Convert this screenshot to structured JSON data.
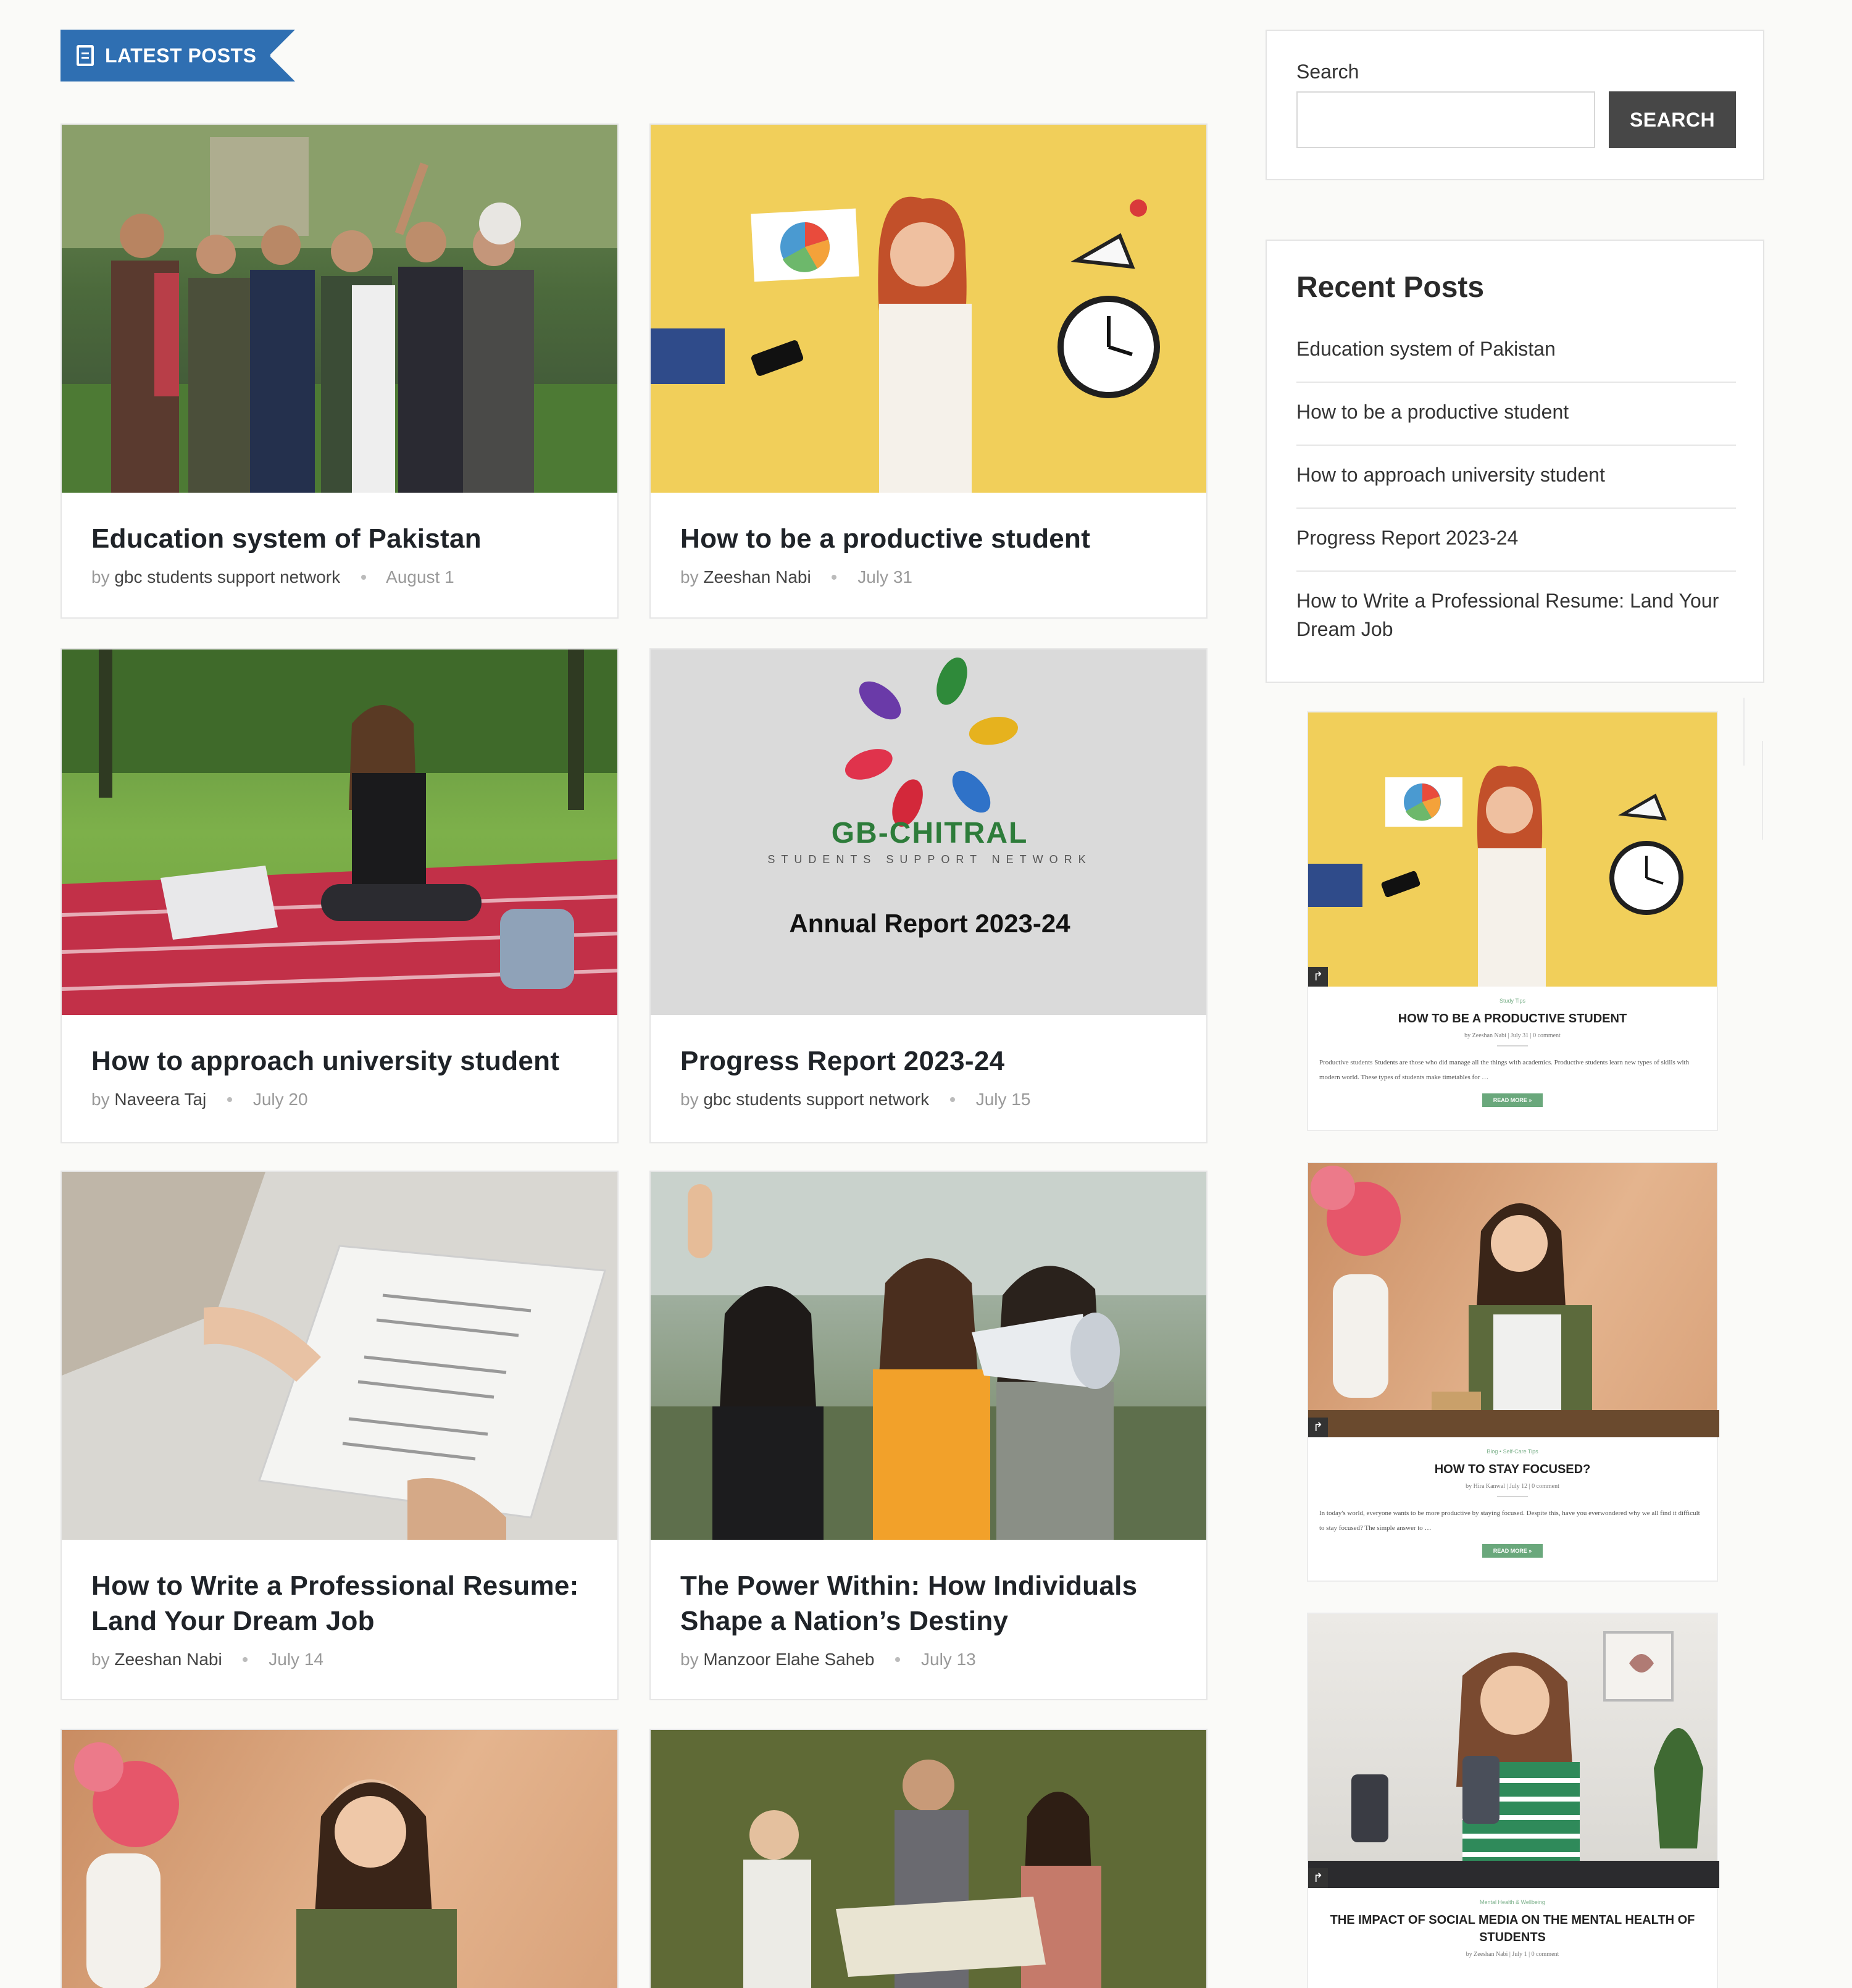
{
  "section_badge": {
    "label": "LATEST POSTS",
    "icon": "document-icon"
  },
  "posts": [
    {
      "title": "Education system of Pakistan",
      "by": "by",
      "author": "gbc students support network",
      "date": "August 1"
    },
    {
      "title": "How to be a productive student",
      "by": "by",
      "author": "Zeeshan Nabi",
      "date": "July 31"
    },
    {
      "title": "How to approach university student",
      "by": "by",
      "author": "Naveera Taj",
      "date": "July 20"
    },
    {
      "title": "Progress Report 2023-24",
      "by": "by",
      "author": "gbc students support network",
      "date": "July 15"
    },
    {
      "title": "How to Write a Professional Resume: Land Your Dream Job",
      "by": "by",
      "author": "Zeeshan Nabi",
      "date": "July 14"
    },
    {
      "title": "The Power Within: How Individuals Shape a Nation’s Destiny",
      "by": "by",
      "author": "Manzoor Elahe Saheb",
      "date": "July 13"
    }
  ],
  "report_image": {
    "brand": "GB-CHITRAL",
    "tagline": "STUDENTS SUPPORT NETWORK",
    "caption": "Annual Report 2023-24"
  },
  "search": {
    "label": "Search",
    "placeholder": "",
    "button": "SEARCH"
  },
  "recent_posts": {
    "title": "Recent Posts",
    "items": [
      "Education system of Pakistan",
      "How to be a productive student",
      "How to approach university student",
      "Progress Report 2023-24",
      "How to Write a Professional Resume: Land Your Dream Job"
    ]
  },
  "mini_posts": [
    {
      "category": "Study Tips",
      "title": "HOW TO BE A PRODUCTIVE STUDENT",
      "meta": "by Zeeshan Nabi  |  July 31  |  0 comment",
      "excerpt": "Productive students Students are those who did manage all the things with academics. Productive students learn new types of skills with modern world. These types of students make timetables for …",
      "read_more": "READ MORE »"
    },
    {
      "category": "Blog  •  Self-Care Tips",
      "title": "HOW TO STAY FOCUSED?",
      "meta": "by Hira Kanwal  |  July 12  |  0 comment",
      "excerpt": "In today's world, everyone wants to be more productive by staying focused. Despite this, have you everwondered why we all find it difficult to stay focused? The simple answer to …",
      "read_more": "READ MORE »"
    },
    {
      "category": "Mental Health & Wellbeing",
      "title": "THE IMPACT OF SOCIAL MEDIA ON THE MENTAL HEALTH OF STUDENTS",
      "meta": "by Zeeshan Nabi  |  July 1  |  0 comment"
    }
  ],
  "colors": {
    "accent_blue": "#2f6fb2",
    "search_button": "#474747",
    "read_more_green": "#6aa87c"
  }
}
